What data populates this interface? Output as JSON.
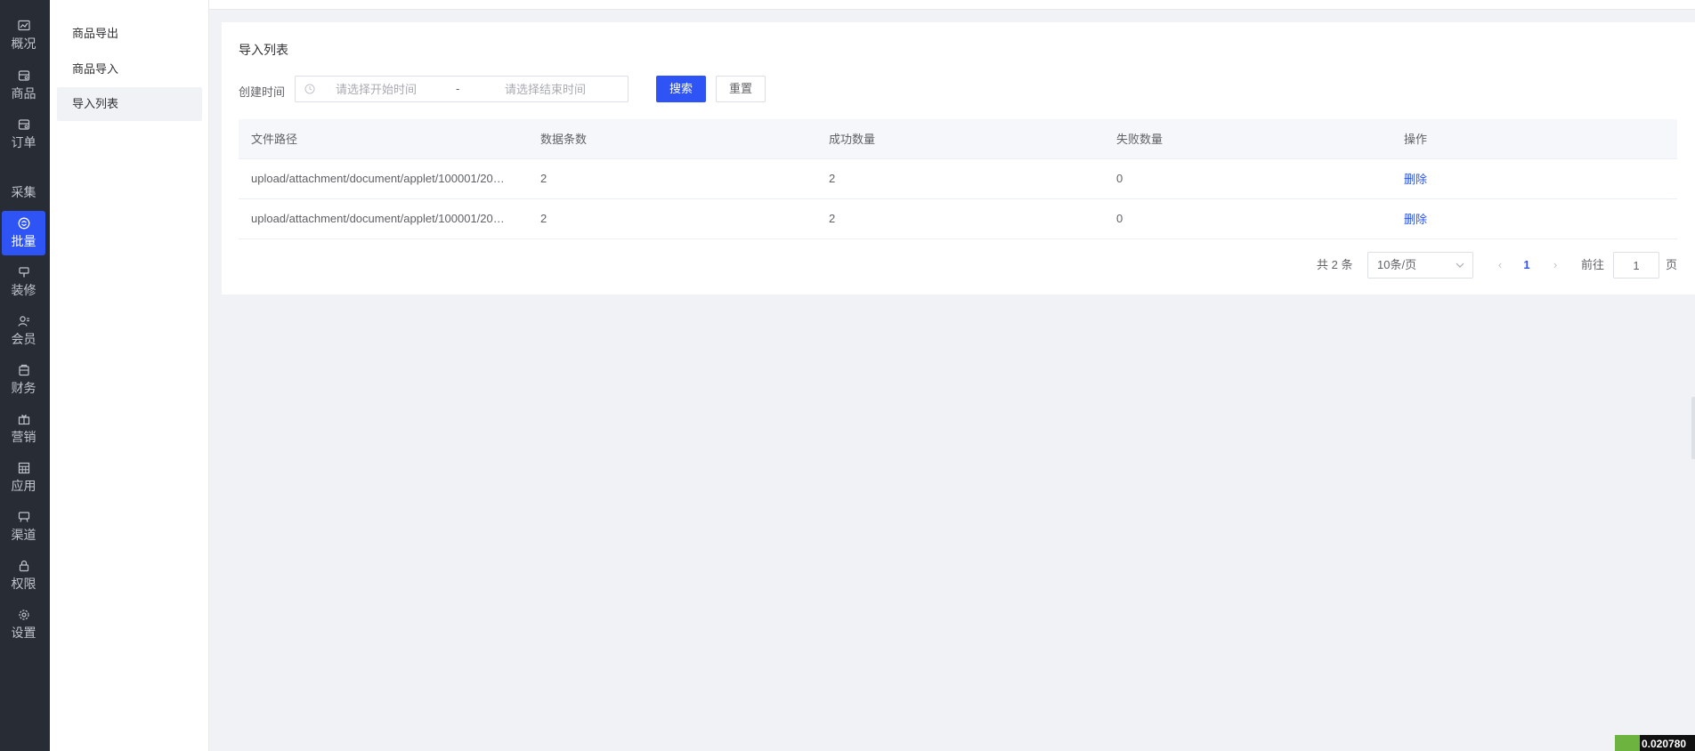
{
  "rail": {
    "items": [
      {
        "label": "概况",
        "icon": "chart-icon"
      },
      {
        "label": "商品",
        "icon": "goods-icon"
      },
      {
        "label": "订单",
        "icon": "order-icon"
      },
      {
        "label": "采集",
        "icon": ""
      },
      {
        "label": "批量",
        "icon": "batch-icon",
        "active": true
      },
      {
        "label": "装修",
        "icon": "decorate-icon"
      },
      {
        "label": "会员",
        "icon": "member-icon"
      },
      {
        "label": "财务",
        "icon": "finance-icon"
      },
      {
        "label": "营销",
        "icon": "gift-icon"
      },
      {
        "label": "应用",
        "icon": "app-grid-icon"
      },
      {
        "label": "渠道",
        "icon": "channel-icon"
      },
      {
        "label": "权限",
        "icon": "lock-icon"
      },
      {
        "label": "设置",
        "icon": "gear-icon"
      }
    ],
    "active_color": "#2e54f5"
  },
  "subnav": {
    "items": [
      {
        "label": "商品导出"
      },
      {
        "label": "商品导入"
      },
      {
        "label": "导入列表",
        "active": true
      }
    ]
  },
  "main": {
    "title": "导入列表",
    "filter": {
      "label": "创建时间",
      "start_placeholder": "请选择开始时间",
      "separator": "-",
      "end_placeholder": "请选择结束时间",
      "search_label": "搜索",
      "reset_label": "重置"
    },
    "table": {
      "columns": [
        "文件路径",
        "数据条数",
        "成功数量",
        "失败数量",
        "操作"
      ],
      "rows": [
        {
          "path": "upload/attachment/document/applet/100001/20…",
          "count": "2",
          "success": "2",
          "fail": "0",
          "action": "删除"
        },
        {
          "path": "upload/attachment/document/applet/100001/20…",
          "count": "2",
          "success": "2",
          "fail": "0",
          "action": "删除"
        }
      ]
    },
    "pagination": {
      "total": "共 2 条",
      "page_size": "10条/页",
      "prev": "‹",
      "current": "1",
      "next": "›",
      "goto_label": "前往",
      "goto_value": "1",
      "page_suffix": "页"
    }
  },
  "corner_widget": {
    "text": "0.020780"
  }
}
